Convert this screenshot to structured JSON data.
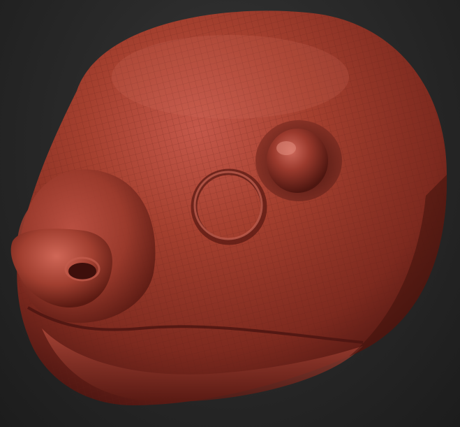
{
  "viewport": {
    "background_color": "#2e2e2e",
    "background_edge_color": "#1c1c1c"
  },
  "model": {
    "name": "sculpted-animal-head",
    "material": {
      "base_color": "#9a3a2c",
      "highlight_color": "#d46a5a",
      "shadow_color": "#4a1410",
      "wire_color": "#5e1f17"
    },
    "features": [
      "head-mass",
      "eye",
      "ear-ring",
      "nose",
      "nostril",
      "mouth-line",
      "lower-lip",
      "wireframe-grid"
    ]
  }
}
